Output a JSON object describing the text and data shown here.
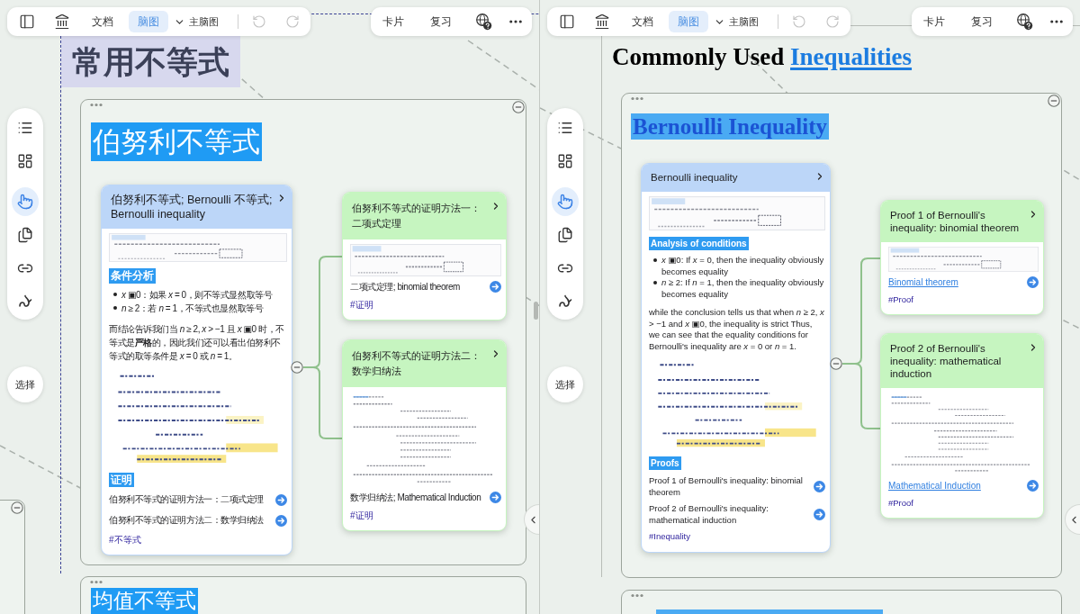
{
  "panes": [
    {
      "toolbar": {
        "tabs": [
          {
            "label": "文档",
            "selected": false
          },
          {
            "label": "脑图",
            "selected": true
          }
        ],
        "map_menu": "主脑图",
        "history": [
          {
            "kind": "undo",
            "disabled": true
          },
          {
            "kind": "redo",
            "disabled": true
          }
        ],
        "actions": [
          "卡片",
          "复习"
        ]
      },
      "tools": [
        {
          "kind": "list",
          "selected": false
        },
        {
          "kind": "layout",
          "selected": false
        },
        {
          "kind": "pointer",
          "selected": true
        },
        {
          "kind": "pages",
          "selected": false
        },
        {
          "kind": "link",
          "selected": false
        },
        {
          "kind": "draw",
          "selected": false
        }
      ],
      "select_button": "选择",
      "title": {
        "kind": "sans",
        "selected": true,
        "text": "常用不等式"
      },
      "group": {
        "heading": {
          "kind": "sans",
          "text": "伯努利不等式"
        },
        "main_card": {
          "color": "#bcd6f8",
          "title": "伯努利不等式; Bernoulli 不等式; Bernoulli inequality",
          "blocks": [
            {
              "kind": "formula"
            },
            {
              "kind": "label",
              "text": "条件分析"
            },
            {
              "kind": "bullets",
              "items": [
                "*x* ▣0：如果 *x* = 0，则不等式显然取等号",
                "*n* ≥ 2：若 *n* = 1，不等式也显然取等号"
              ]
            },
            {
              "kind": "paragraph",
              "text": "而结论告诉我们当 *n* ≥ 2, *x* > −1 且 *x* ▣0 时，不等式是**严格**的，因此我们还可以看出伯努利不等式的取等条件是 *x* = 0 或 *n* = 1。"
            },
            {
              "kind": "notes"
            },
            {
              "kind": "label",
              "text": "证明"
            },
            {
              "kind": "ref",
              "text": "伯努利不等式的证明方法一：二项式定理",
              "linked": false
            },
            {
              "kind": "ref",
              "text": "伯努利不等式的证明方法二：数学归纳法",
              "linked": false
            },
            {
              "kind": "tag",
              "text": "#不等式"
            }
          ]
        },
        "child_cards": [
          {
            "color": "#c6f5c0",
            "title": "伯努利不等式的证明方法一：二项式定理",
            "blocks": [
              {
                "kind": "formula"
              },
              {
                "kind": "ref",
                "text": "二项式定理; binomial theorem",
                "linked": false
              },
              {
                "kind": "tag",
                "text": "#证明"
              }
            ]
          },
          {
            "color": "#c6f5c0",
            "title": "伯努利不等式的证明方法二：数学归纳法",
            "blocks": [
              {
                "kind": "steps"
              },
              {
                "kind": "ref",
                "text": "数学归纳法; Mathematical Induction",
                "linked": false
              },
              {
                "kind": "tag",
                "text": "#证明"
              }
            ]
          }
        ]
      },
      "next_group": {
        "heading": {
          "kind": "sans",
          "text": "均值不等式"
        }
      }
    },
    {
      "toolbar": {
        "tabs": [
          {
            "label": "文档",
            "selected": false
          },
          {
            "label": "脑图",
            "selected": true
          }
        ],
        "map_menu": "主脑图",
        "history": [
          {
            "kind": "undo",
            "disabled": true
          },
          {
            "kind": "redo",
            "disabled": true
          }
        ],
        "actions": [
          "卡片",
          "复习"
        ]
      },
      "tools": [
        {
          "kind": "list",
          "selected": false
        },
        {
          "kind": "layout",
          "selected": false
        },
        {
          "kind": "pointer",
          "selected": true
        },
        {
          "kind": "pages",
          "selected": false
        },
        {
          "kind": "link",
          "selected": false
        },
        {
          "kind": "draw",
          "selected": false
        }
      ],
      "select_button": "选择",
      "title": {
        "kind": "serif",
        "selected": false,
        "text": "Commonly Used",
        "link": "Inequalities"
      },
      "group": {
        "heading": {
          "kind": "serif",
          "text": "Bernoulli Inequality"
        },
        "main_card": {
          "color": "#bcd6f8",
          "title": "Bernoulli inequality",
          "blocks": [
            {
              "kind": "formula"
            },
            {
              "kind": "label",
              "text": "Analysis of conditions"
            },
            {
              "kind": "bullets",
              "items": [
                "*x* ▣0: If *x* = 0, then the inequality obviously becomes equality",
                "*n* ≥ 2: If *n* = 1, then the inequality obviously becomes equality"
              ]
            },
            {
              "kind": "paragraph",
              "text": "while the conclusion tells us that when *n* ≥ 2, *x* > −1 and *x* ▣0, the inequality is strict Thus, we can see that the equality conditions for Bernoulli's inequality are *x* = 0 or *n* = 1."
            },
            {
              "kind": "notes"
            },
            {
              "kind": "label",
              "text": "Proofs"
            },
            {
              "kind": "ref",
              "text": "Proof 1 of Bernoulli's inequality: binomial theorem",
              "linked": false
            },
            {
              "kind": "ref",
              "text": "Proof 2 of Bernoulli's inequality: mathematical induction",
              "linked": false
            },
            {
              "kind": "tag",
              "text": "#Inequality"
            }
          ]
        },
        "child_cards": [
          {
            "color": "#c6f5c0",
            "title": "Proof 1 of Bernoulli's inequality: binomial theorem",
            "blocks": [
              {
                "kind": "formula"
              },
              {
                "kind": "ref",
                "text": "Binomial theorem",
                "linked": true
              },
              {
                "kind": "tag",
                "text": "#Proof"
              }
            ]
          },
          {
            "color": "#c6f5c0",
            "title": "Proof 2 of Bernoulli's inequality: mathematical induction",
            "blocks": [
              {
                "kind": "steps"
              },
              {
                "kind": "ref",
                "text": "Mathematical Induction",
                "linked": true
              },
              {
                "kind": "tag",
                "text": "#Proof"
              }
            ]
          }
        ]
      },
      "next_group": {
        "heading": {
          "kind": "serif"
        }
      }
    }
  ]
}
